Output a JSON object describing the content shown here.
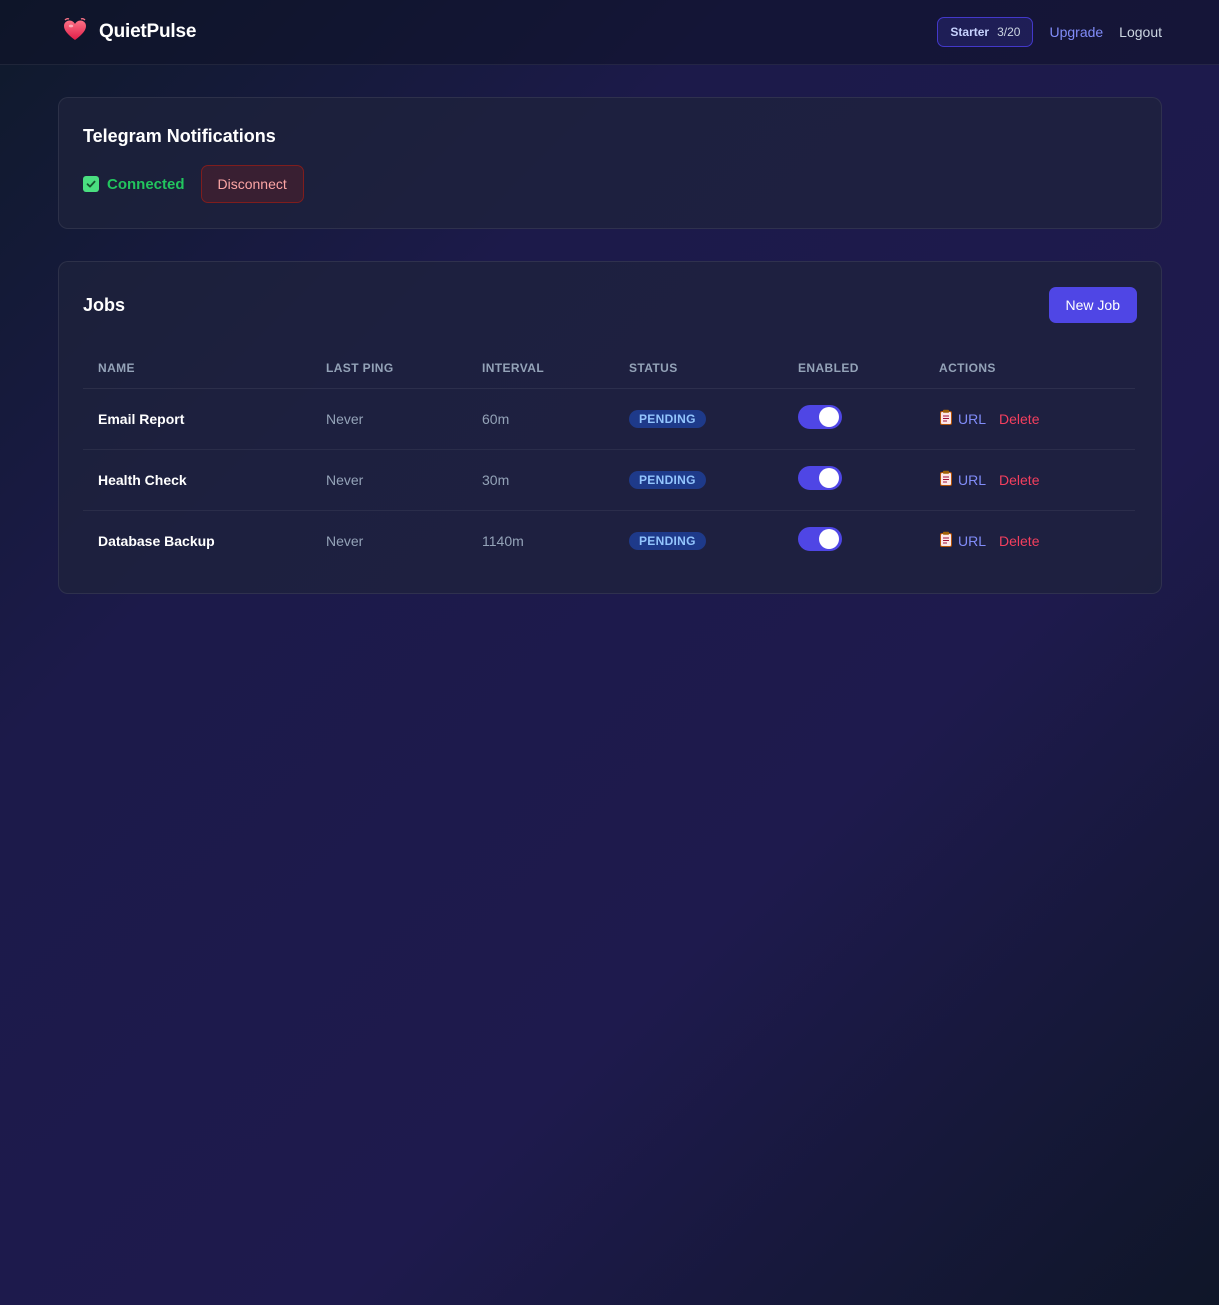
{
  "header": {
    "brand": "QuietPulse",
    "plan_name": "Starter",
    "plan_usage": "3/20",
    "upgrade_label": "Upgrade",
    "logout_label": "Logout",
    "logo_icon": "heart-pulse-icon"
  },
  "telegram": {
    "title": "Telegram Notifications",
    "status_label": "Connected",
    "disconnect_label": "Disconnect"
  },
  "jobs": {
    "title": "Jobs",
    "new_job_label": "New Job",
    "columns": [
      "NAME",
      "LAST PING",
      "INTERVAL",
      "STATUS",
      "ENABLED",
      "ACTIONS"
    ],
    "rows": [
      {
        "name": "Email Report",
        "last_ping": "Never",
        "interval": "60m",
        "status": "PENDING",
        "enabled": true,
        "url_label": "URL",
        "delete_label": "Delete"
      },
      {
        "name": "Health Check",
        "last_ping": "Never",
        "interval": "30m",
        "status": "PENDING",
        "enabled": true,
        "url_label": "URL",
        "delete_label": "Delete"
      },
      {
        "name": "Database Backup",
        "last_ping": "Never",
        "interval": "1140m",
        "status": "PENDING",
        "enabled": true,
        "url_label": "URL",
        "delete_label": "Delete"
      }
    ]
  },
  "colors": {
    "accent": "#4f46e5",
    "success": "#22c55e",
    "danger": "#f43f5e",
    "link": "#818cf8"
  }
}
